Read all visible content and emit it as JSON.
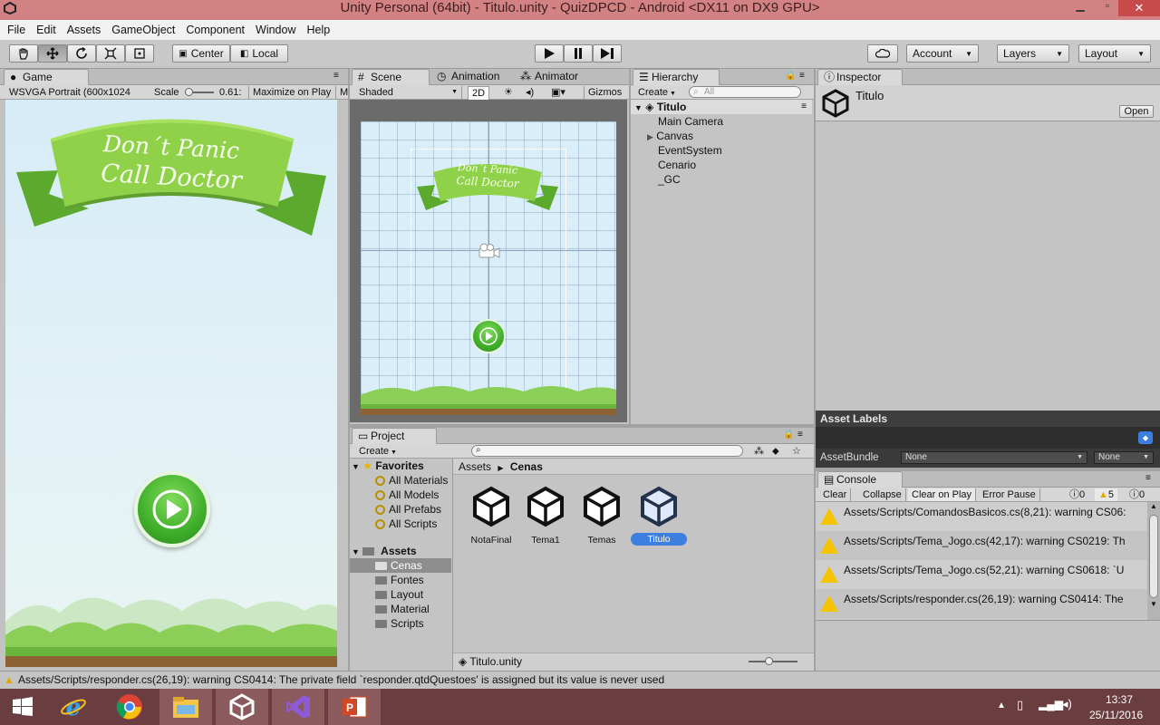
{
  "window": {
    "title": "Unity Personal (64bit) - Titulo.unity - QuizDPCD - Android <DX11 on DX9 GPU>"
  },
  "menu": [
    "File",
    "Edit",
    "Assets",
    "GameObject",
    "Component",
    "Window",
    "Help"
  ],
  "toolbar": {
    "center": "Center",
    "local": "Local",
    "account": "Account",
    "layers": "Layers",
    "layout": "Layout"
  },
  "game": {
    "tab": "Game",
    "resolution": "WSVGA Portrait (600x1024",
    "scale_label": "Scale",
    "scale_value": "0.61:",
    "maximize": "Maximize on Play",
    "extra": "M",
    "banner_line1": "Don´t Panic",
    "banner_line2": "Call Doctor"
  },
  "scene": {
    "tabs": [
      "Scene",
      "Animation",
      "Animator"
    ],
    "shaded": "Shaded",
    "mode2d": "2D",
    "gizmos": "Gizmos",
    "banner_line1": "Don´t Panic",
    "banner_line2": "Call Doctor"
  },
  "hierarchy": {
    "tab": "Hierarchy",
    "create": "Create",
    "search_placeholder": "All",
    "root": "Titulo",
    "items": [
      "Main Camera",
      "Canvas",
      "EventSystem",
      "Cenario",
      "_GC"
    ]
  },
  "inspector": {
    "tab": "Inspector",
    "object": "Titulo",
    "open": "Open",
    "asset_labels": "Asset Labels",
    "assetbundle_label": "AssetBundle",
    "bundle_value": "None",
    "variant_value": "None"
  },
  "project": {
    "tab": "Project",
    "create": "Create",
    "favorites_label": "Favorites",
    "favorites": [
      "All Materials",
      "All Models",
      "All Prefabs",
      "All Scripts"
    ],
    "assets_label": "Assets",
    "folders": [
      "Cenas",
      "Fontes",
      "Layout",
      "Material",
      "Scripts"
    ],
    "breadcrumb_root": "Assets",
    "breadcrumb_current": "Cenas",
    "files": [
      "NotaFinal",
      "Tema1",
      "Temas",
      "Titulo"
    ],
    "footer_file": "Titulo.unity"
  },
  "console": {
    "tab": "Console",
    "buttons": [
      "Clear",
      "Collapse",
      "Clear on Play",
      "Error Pause"
    ],
    "count_info": "0",
    "count_warn": "5",
    "count_error": "0",
    "messages": [
      "Assets/Scripts/ComandosBasicos.cs(8,21): warning CS06:",
      "Assets/Scripts/Tema_Jogo.cs(42,17): warning CS0219: Th",
      "Assets/Scripts/Tema_Jogo.cs(52,21): warning CS0618: `U",
      "Assets/Scripts/responder.cs(26,19): warning CS0414: The"
    ]
  },
  "statusbar": {
    "message": "Assets/Scripts/responder.cs(26,19): warning CS0414: The private field `responder.qtdQuestoes' is assigned but its value is never used"
  },
  "taskbar": {
    "time": "13:37",
    "date": "25/11/2016"
  },
  "colors": {
    "titlebar": "#d38283",
    "taskbar": "#6a3e40",
    "green_button": "#3fae2a",
    "selection_blue": "#3d7fe0"
  }
}
